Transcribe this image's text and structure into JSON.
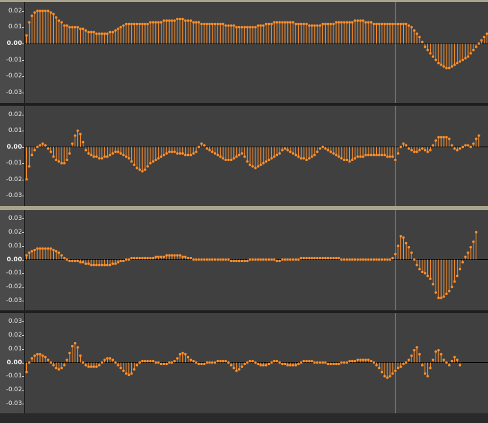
{
  "colors": {
    "waveform": "#ff8f2a",
    "background": "#404040",
    "scale_background": "#4a4a4a",
    "cursor": "#9a9a80",
    "zero_line": "#000000"
  },
  "cursor_sample": 137,
  "tracks": [
    {
      "id": "track-1",
      "tick_labels": [
        "0.02",
        "0.01",
        "0.00",
        "-0.01",
        "-0.02",
        "-0.03"
      ],
      "range": [
        -0.033,
        0.022
      ],
      "samples": [
        0.005,
        0.013,
        0.017,
        0.019,
        0.02,
        0.02,
        0.02,
        0.02,
        0.02,
        0.019,
        0.018,
        0.016,
        0.014,
        0.013,
        0.011,
        0.011,
        0.01,
        0.01,
        0.01,
        0.01,
        0.009,
        0.009,
        0.008,
        0.007,
        0.007,
        0.007,
        0.006,
        0.006,
        0.006,
        0.006,
        0.006,
        0.007,
        0.007,
        0.008,
        0.009,
        0.01,
        0.011,
        0.012,
        0.012,
        0.012,
        0.012,
        0.012,
        0.012,
        0.012,
        0.012,
        0.012,
        0.013,
        0.013,
        0.013,
        0.013,
        0.013,
        0.014,
        0.014,
        0.014,
        0.014,
        0.014,
        0.015,
        0.015,
        0.015,
        0.014,
        0.014,
        0.014,
        0.013,
        0.013,
        0.013,
        0.012,
        0.012,
        0.012,
        0.012,
        0.012,
        0.012,
        0.012,
        0.012,
        0.012,
        0.011,
        0.011,
        0.011,
        0.011,
        0.01,
        0.01,
        0.01,
        0.01,
        0.01,
        0.01,
        0.01,
        0.01,
        0.011,
        0.011,
        0.011,
        0.012,
        0.012,
        0.012,
        0.013,
        0.013,
        0.013,
        0.013,
        0.013,
        0.013,
        0.013,
        0.013,
        0.012,
        0.012,
        0.012,
        0.012,
        0.012,
        0.011,
        0.011,
        0.011,
        0.011,
        0.011,
        0.012,
        0.012,
        0.012,
        0.012,
        0.012,
        0.013,
        0.013,
        0.013,
        0.013,
        0.013,
        0.013,
        0.013,
        0.014,
        0.014,
        0.014,
        0.014,
        0.013,
        0.013,
        0.013,
        0.012,
        0.012,
        0.012,
        0.012,
        0.012,
        0.012,
        0.012,
        0.012,
        0.012,
        0.012,
        0.012,
        0.012,
        0.012,
        0.011,
        0.01,
        0.008,
        0.006,
        0.004,
        0.001,
        -0.002,
        -0.004,
        -0.006,
        -0.008,
        -0.01,
        -0.012,
        -0.013,
        -0.014,
        -0.015,
        -0.015,
        -0.014,
        -0.013,
        -0.012,
        -0.011,
        -0.01,
        -0.009,
        -0.008,
        -0.006,
        -0.004,
        -0.002,
        0.0,
        0.002,
        0.004,
        0.006,
        0.008,
        0.01,
        0.012,
        0.014
      ]
    },
    {
      "id": "track-2",
      "tick_labels": [
        "0.02",
        "0.01",
        "0.00",
        "-0.01",
        "-0.02",
        "-0.03"
      ],
      "range": [
        -0.033,
        0.022
      ],
      "samples": [
        -0.02,
        -0.012,
        -0.005,
        -0.002,
        0.0,
        0.001,
        0.002,
        0.001,
        -0.001,
        -0.003,
        -0.006,
        -0.008,
        -0.009,
        -0.01,
        -0.01,
        -0.008,
        -0.004,
        0.002,
        0.007,
        0.01,
        0.008,
        0.003,
        -0.002,
        -0.004,
        -0.005,
        -0.006,
        -0.006,
        -0.007,
        -0.007,
        -0.006,
        -0.006,
        -0.005,
        -0.004,
        -0.003,
        -0.003,
        -0.004,
        -0.005,
        -0.006,
        -0.007,
        -0.009,
        -0.011,
        -0.013,
        -0.014,
        -0.015,
        -0.014,
        -0.012,
        -0.01,
        -0.009,
        -0.008,
        -0.007,
        -0.006,
        -0.005,
        -0.004,
        -0.003,
        -0.003,
        -0.003,
        -0.004,
        -0.004,
        -0.004,
        -0.005,
        -0.005,
        -0.005,
        -0.004,
        -0.003,
        0.0,
        0.002,
        0.001,
        -0.001,
        -0.002,
        -0.003,
        -0.004,
        -0.005,
        -0.006,
        -0.007,
        -0.008,
        -0.008,
        -0.008,
        -0.007,
        -0.006,
        -0.005,
        -0.004,
        -0.006,
        -0.009,
        -0.011,
        -0.012,
        -0.013,
        -0.012,
        -0.011,
        -0.01,
        -0.009,
        -0.008,
        -0.007,
        -0.006,
        -0.005,
        -0.004,
        -0.002,
        -0.001,
        -0.002,
        -0.003,
        -0.004,
        -0.005,
        -0.006,
        -0.007,
        -0.007,
        -0.008,
        -0.007,
        -0.006,
        -0.005,
        -0.003,
        -0.001,
        0.0,
        -0.001,
        -0.002,
        -0.003,
        -0.004,
        -0.005,
        -0.006,
        -0.007,
        -0.008,
        -0.008,
        -0.009,
        -0.008,
        -0.007,
        -0.006,
        -0.006,
        -0.006,
        -0.005,
        -0.005,
        -0.005,
        -0.005,
        -0.005,
        -0.005,
        -0.005,
        -0.005,
        -0.006,
        -0.006,
        -0.006,
        -0.008,
        -0.004,
        0.0,
        0.002,
        0.001,
        -0.001,
        -0.002,
        -0.003,
        -0.003,
        -0.002,
        -0.001,
        -0.002,
        -0.003,
        -0.002,
        0.001,
        0.004,
        0.006,
        0.006,
        0.006,
        0.006,
        0.005,
        0.001,
        -0.001,
        -0.002,
        -0.001,
        0.0,
        0.001,
        0.001,
        0.0,
        0.002,
        0.005,
        0.007
      ]
    },
    {
      "id": "track-3",
      "tick_labels": [
        "0.03",
        "0.02",
        "0.01",
        "0.00",
        "-0.01",
        "-0.02",
        "-0.03"
      ],
      "range": [
        -0.033,
        0.032
      ],
      "samples": [
        0.003,
        0.005,
        0.006,
        0.007,
        0.008,
        0.008,
        0.008,
        0.008,
        0.008,
        0.008,
        0.007,
        0.006,
        0.005,
        0.003,
        0.001,
        0.0,
        -0.001,
        -0.001,
        -0.001,
        -0.001,
        -0.002,
        -0.002,
        -0.003,
        -0.003,
        -0.004,
        -0.004,
        -0.004,
        -0.004,
        -0.004,
        -0.004,
        -0.004,
        -0.004,
        -0.003,
        -0.003,
        -0.002,
        -0.001,
        -0.001,
        0.0,
        0.0,
        0.001,
        0.001,
        0.001,
        0.001,
        0.001,
        0.001,
        0.001,
        0.001,
        0.001,
        0.002,
        0.002,
        0.002,
        0.002,
        0.003,
        0.003,
        0.003,
        0.003,
        0.003,
        0.003,
        0.002,
        0.002,
        0.001,
        0.001,
        0.0,
        0.0,
        0.0,
        0.0,
        0.0,
        0.0,
        0.0,
        0.0,
        0.0,
        0.0,
        0.0,
        0.0,
        0.0,
        0.0,
        -0.001,
        -0.001,
        -0.001,
        -0.001,
        -0.001,
        -0.001,
        -0.001,
        0.0,
        0.0,
        0.0,
        0.0,
        0.0,
        0.0,
        0.0,
        0.0,
        0.0,
        0.0,
        -0.001,
        -0.001,
        0.0,
        0.0,
        0.0,
        0.0,
        0.0,
        0.0,
        0.0,
        0.001,
        0.001,
        0.001,
        0.001,
        0.001,
        0.001,
        0.001,
        0.001,
        0.001,
        0.001,
        0.001,
        0.001,
        0.001,
        0.001,
        0.001,
        0.0,
        0.0,
        0.0,
        0.0,
        0.0,
        0.0,
        0.0,
        0.0,
        0.0,
        0.0,
        0.0,
        0.0,
        0.0,
        0.0,
        0.0,
        0.0,
        0.0,
        0.0,
        0.0,
        0.001,
        0.004,
        0.01,
        0.017,
        0.016,
        0.012,
        0.009,
        0.005,
        0.0,
        -0.004,
        -0.007,
        -0.009,
        -0.01,
        -0.012,
        -0.014,
        -0.018,
        -0.024,
        -0.028,
        -0.028,
        -0.027,
        -0.025,
        -0.023,
        -0.02,
        -0.016,
        -0.012,
        -0.007,
        -0.002,
        0.002,
        0.005,
        0.009,
        0.013,
        0.02
      ]
    },
    {
      "id": "track-4",
      "tick_labels": [
        "0.03",
        "0.02",
        "0.01",
        "0.00",
        "-0.01",
        "-0.02",
        "-0.03"
      ],
      "range": [
        -0.033,
        0.032
      ],
      "samples": [
        -0.007,
        0.0,
        0.003,
        0.005,
        0.006,
        0.006,
        0.005,
        0.004,
        0.002,
        0.0,
        -0.002,
        -0.004,
        -0.005,
        -0.004,
        -0.002,
        0.002,
        0.007,
        0.012,
        0.014,
        0.011,
        0.005,
        0.0,
        -0.002,
        -0.003,
        -0.003,
        -0.003,
        -0.003,
        -0.002,
        0.0,
        0.002,
        0.003,
        0.003,
        0.002,
        0.0,
        -0.002,
        -0.004,
        -0.006,
        -0.008,
        -0.009,
        -0.008,
        -0.005,
        -0.002,
        0.0,
        0.001,
        0.001,
        0.001,
        0.001,
        0.001,
        0.0,
        0.0,
        -0.001,
        -0.001,
        -0.001,
        0.0,
        0.0,
        0.001,
        0.003,
        0.006,
        0.007,
        0.006,
        0.004,
        0.002,
        0.001,
        0.0,
        -0.001,
        -0.001,
        -0.001,
        0.0,
        0.0,
        0.0,
        0.0,
        0.001,
        0.001,
        0.001,
        0.001,
        0.0,
        -0.002,
        -0.004,
        -0.006,
        -0.005,
        -0.003,
        -0.001,
        0.0,
        0.001,
        0.001,
        0.0,
        -0.001,
        -0.002,
        -0.002,
        -0.002,
        -0.001,
        0.0,
        0.001,
        0.001,
        0.0,
        -0.001,
        -0.001,
        -0.002,
        -0.002,
        -0.002,
        -0.002,
        -0.001,
        0.0,
        0.001,
        0.001,
        0.001,
        0.001,
        0.0,
        0.0,
        0.0,
        0.0,
        0.0,
        -0.001,
        -0.001,
        -0.001,
        -0.001,
        -0.001,
        0.0,
        0.0,
        0.0,
        0.001,
        0.001,
        0.001,
        0.002,
        0.002,
        0.002,
        0.002,
        0.002,
        0.001,
        0.0,
        -0.002,
        -0.004,
        -0.007,
        -0.01,
        -0.011,
        -0.01,
        -0.008,
        -0.006,
        -0.004,
        -0.003,
        -0.001,
        0.0,
        0.002,
        0.005,
        0.009,
        0.011,
        0.006,
        -0.002,
        -0.008,
        -0.01,
        -0.004,
        0.002,
        0.008,
        0.009,
        0.006,
        0.002,
        0.0,
        -0.002,
        0.001,
        0.004,
        0.002,
        -0.002
      ]
    }
  ]
}
